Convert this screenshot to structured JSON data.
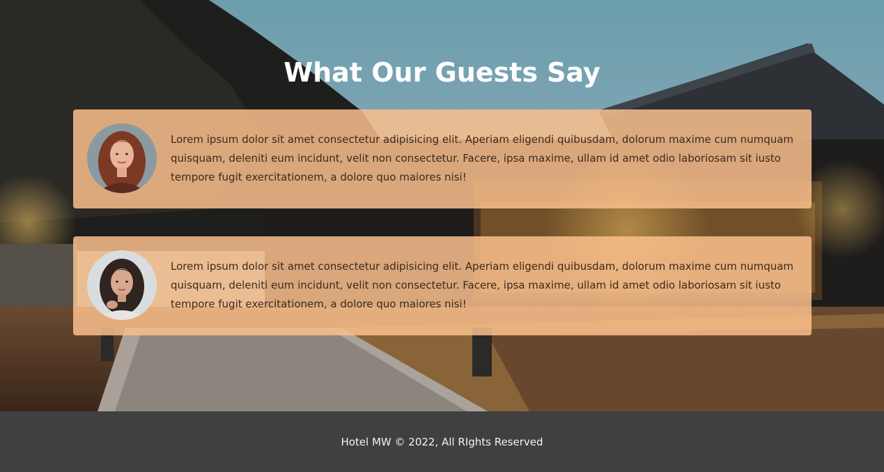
{
  "section": {
    "title": "What Our Guests Say"
  },
  "testimonials": [
    {
      "avatar_icon": "woman-red-hair-portrait",
      "text": "Lorem ipsum dolor sit amet consectetur adipisicing elit. Aperiam eligendi quibusdam, dolorum maxime cum numquam quisquam, deleniti eum incidunt, velit non consectetur. Facere, ipsa maxime, ullam id amet odio laboriosam sit iusto tempore fugit exercitationem, a dolore quo maiores nisi!"
    },
    {
      "avatar_icon": "woman-dark-hair-portrait",
      "text": "Lorem ipsum dolor sit amet consectetur adipisicing elit. Aperiam eligendi quibusdam, dolorum maxime cum numquam quisquam, deleniti eum incidunt, velit non consectetur. Facere, ipsa maxime, ullam id amet odio laboriosam sit iusto tempore fugit exercitationem, a dolore quo maiores nisi!"
    }
  ],
  "footer": {
    "text": "Hotel MW © 2022, All RIghts Reserved"
  },
  "colors": {
    "card": "#f7c18c",
    "footer": "#404040",
    "title": "#ffffff"
  }
}
